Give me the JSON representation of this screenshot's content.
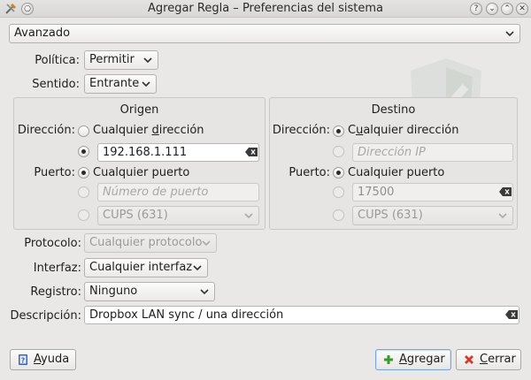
{
  "window": {
    "title": "Agregar Regla – Preferencias del sistema"
  },
  "mode": {
    "value": "Avanzado"
  },
  "policy": {
    "label": "Política:",
    "value": "Permitir"
  },
  "direction": {
    "label": "Sentido:",
    "value": "Entrante"
  },
  "origin": {
    "title": "Origen",
    "address_label": "Dirección:",
    "any_address_pre": "Cualquier ",
    "any_address_key": "d",
    "any_address_post": "irección",
    "address_value": "192.168.1.111",
    "port_label": "Puerto:",
    "any_port": "Cualquier puerto",
    "port_placeholder": "Número de puerto",
    "service_value": "CUPS (631)"
  },
  "destination": {
    "title": "Destino",
    "address_label": "Dirección:",
    "any_address_pre": "C",
    "any_address_key": "u",
    "any_address_post": "alquier dirección",
    "address_placeholder": "Dirección IP",
    "port_label": "Puerto:",
    "any_port": "Cualquier puerto",
    "port_value": "17500",
    "service_value": "CUPS (631)"
  },
  "protocol": {
    "label": "Protocolo:",
    "value": "Cualquier protocolo"
  },
  "interface": {
    "label": "Interfaz:",
    "value": "Cualquier interfaz"
  },
  "logging": {
    "label": "Registro:",
    "value": "Ninguno"
  },
  "description": {
    "label": "Descripción:",
    "value": "Dropbox LAN sync / una dirección"
  },
  "buttons": {
    "help_key": "A",
    "help_rest": "yuda",
    "add_key": "A",
    "add_rest": "gregar",
    "cancel_key": "C",
    "cancel_rest": "errar"
  },
  "colors": {
    "accent": "#7aa7d6",
    "add_icon": "#3a9a2e",
    "cancel_icon": "#d43a2a",
    "help_icon": "#3d63b8"
  },
  "icons": [
    "tools-icon",
    "help-circle-icon",
    "minimize-icon",
    "maximize-icon",
    "close-icon",
    "shield-watermark-icon",
    "chevron-down-icon",
    "clear-text-icon",
    "help-book-icon",
    "add-plus-icon",
    "cancel-x-icon"
  ]
}
